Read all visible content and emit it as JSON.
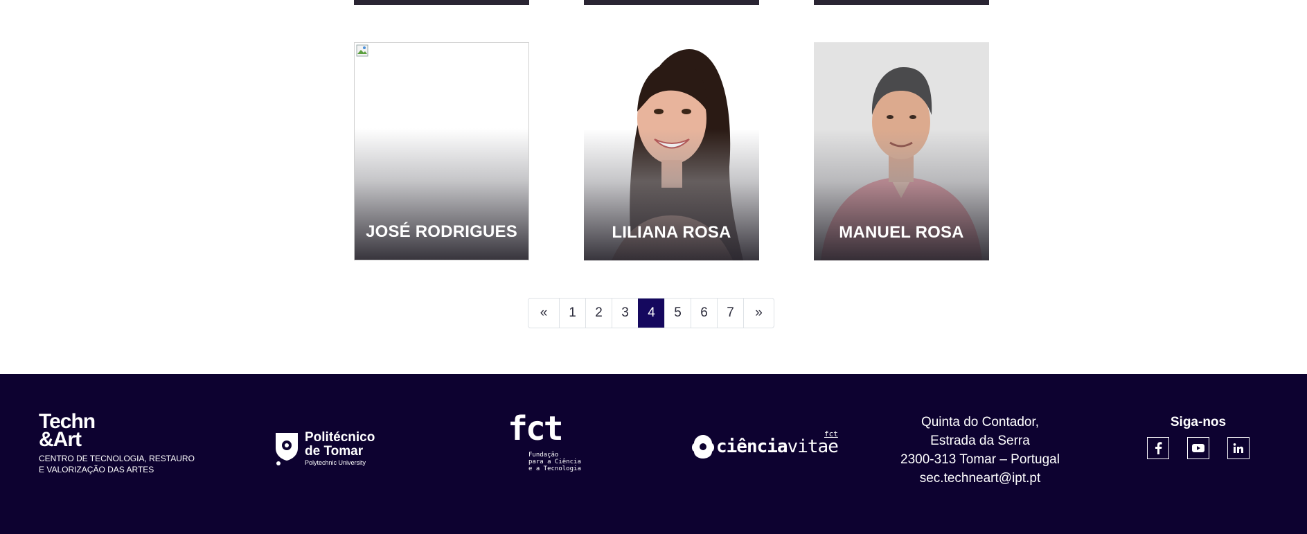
{
  "team_cards": [
    {
      "name": "JOSÉ RODRIGUES",
      "photo": "broken-image"
    },
    {
      "name": "LILIANA ROSA",
      "photo": "portrait-woman"
    },
    {
      "name": "MANUEL ROSA",
      "photo": "portrait-man"
    }
  ],
  "pagination": {
    "prev": "«",
    "pages": [
      "1",
      "2",
      "3",
      "4",
      "5",
      "6",
      "7"
    ],
    "active": "4",
    "next": "»"
  },
  "footer": {
    "techn_art": {
      "line1": "Techn",
      "line2": "&Art",
      "sub1": "CENTRO DE TECNOLOGIA, RESTAURO",
      "sub2": "E VALORIZAÇÃO DAS ARTES"
    },
    "ipt": {
      "line1": "Politécnico",
      "line2": "de Tomar",
      "line3": "Polytechnic University"
    },
    "fct": {
      "mark": "fct",
      "sub1": "Fundação",
      "sub2": "para a Ciência",
      "sub3": "e a Tecnologia"
    },
    "cienciavitae": {
      "bold": "ciência",
      "light": "vitae",
      "mini": "fct"
    },
    "address": [
      "Quinta do Contador,",
      "Estrada da Serra",
      "2300-313 Tomar – Portugal",
      "sec.techneart@ipt.pt"
    ],
    "social": {
      "title": "Siga-nos",
      "icons": [
        "facebook-icon",
        "youtube-icon",
        "linkedin-icon"
      ]
    },
    "background_color": "#0d0230"
  },
  "colors": {
    "pagination_active": "#15085e"
  }
}
